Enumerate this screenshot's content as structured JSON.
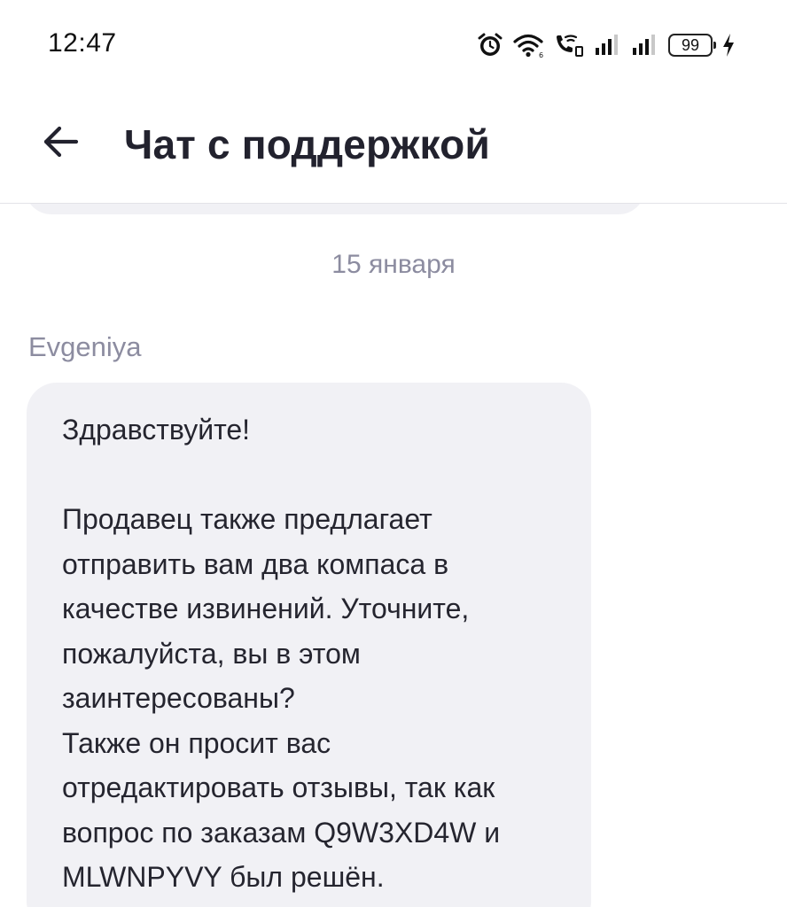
{
  "status_bar": {
    "time": "12:47",
    "battery_level": "99",
    "icons": [
      "alarm-icon",
      "wifi-icon",
      "wifi-calling-icon",
      "signal-icon",
      "signal-icon",
      "battery-icon",
      "charging-icon"
    ]
  },
  "header": {
    "back_icon": "arrow-left-icon",
    "title": "Чат с поддержкой"
  },
  "chat": {
    "date_divider": "15 января",
    "messages": [
      {
        "sender": "Evgeniya",
        "text": "Здравствуйте!\n\nПродавец также предлагает\nотправить вам два компаса в\nкачестве извинений. Уточните,\nпожалуйста, вы в этом\nзаинтересованы?\nТакже он просит вас\nотредактировать отзывы, так как\nвопрос по заказам Q9W3XD4W и\nMLWNPYVY был решён."
      }
    ]
  },
  "colors": {
    "bubble_bg": "#f1f1f5",
    "muted_text": "#8c8ca0",
    "title_text": "#22222e"
  }
}
